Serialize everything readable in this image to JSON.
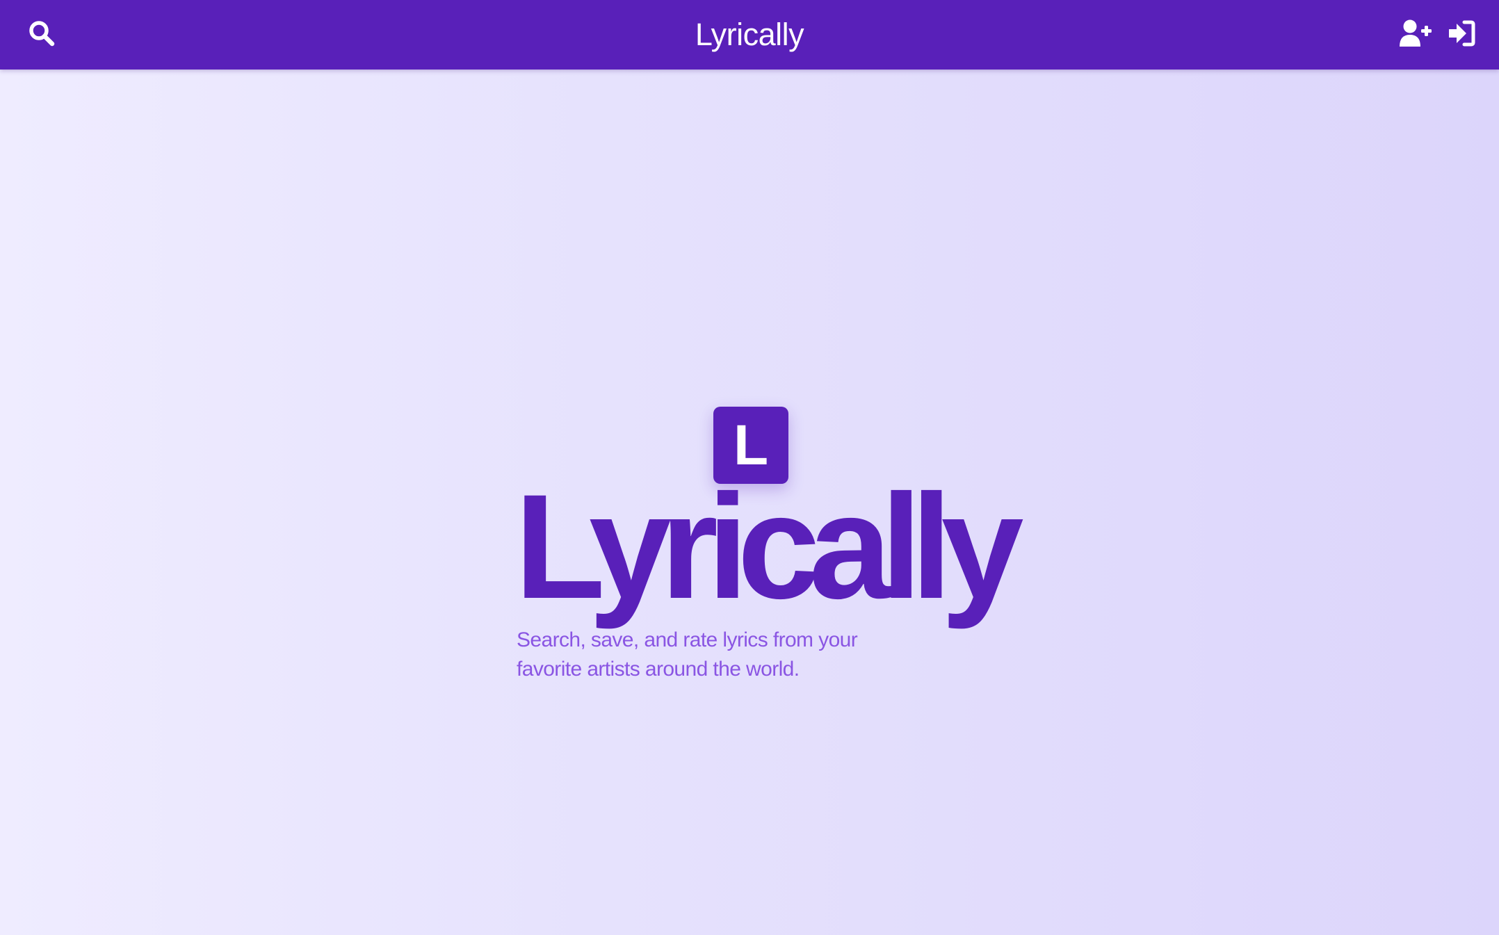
{
  "header": {
    "title": "Lyrically",
    "search_icon": "search-icon",
    "signup_icon": "user-plus-icon",
    "login_icon": "sign-in-icon"
  },
  "hero": {
    "logo_letter": "L",
    "title": "Lyrically",
    "subtitle": "Search, save, and rate lyrics from your favorite artists around the world."
  },
  "colors": {
    "brand": "#5920b9",
    "subtitle": "#8a55e3",
    "background_start": "#efecff",
    "background_end": "#dcd5fb",
    "header_text": "#ffffff"
  }
}
